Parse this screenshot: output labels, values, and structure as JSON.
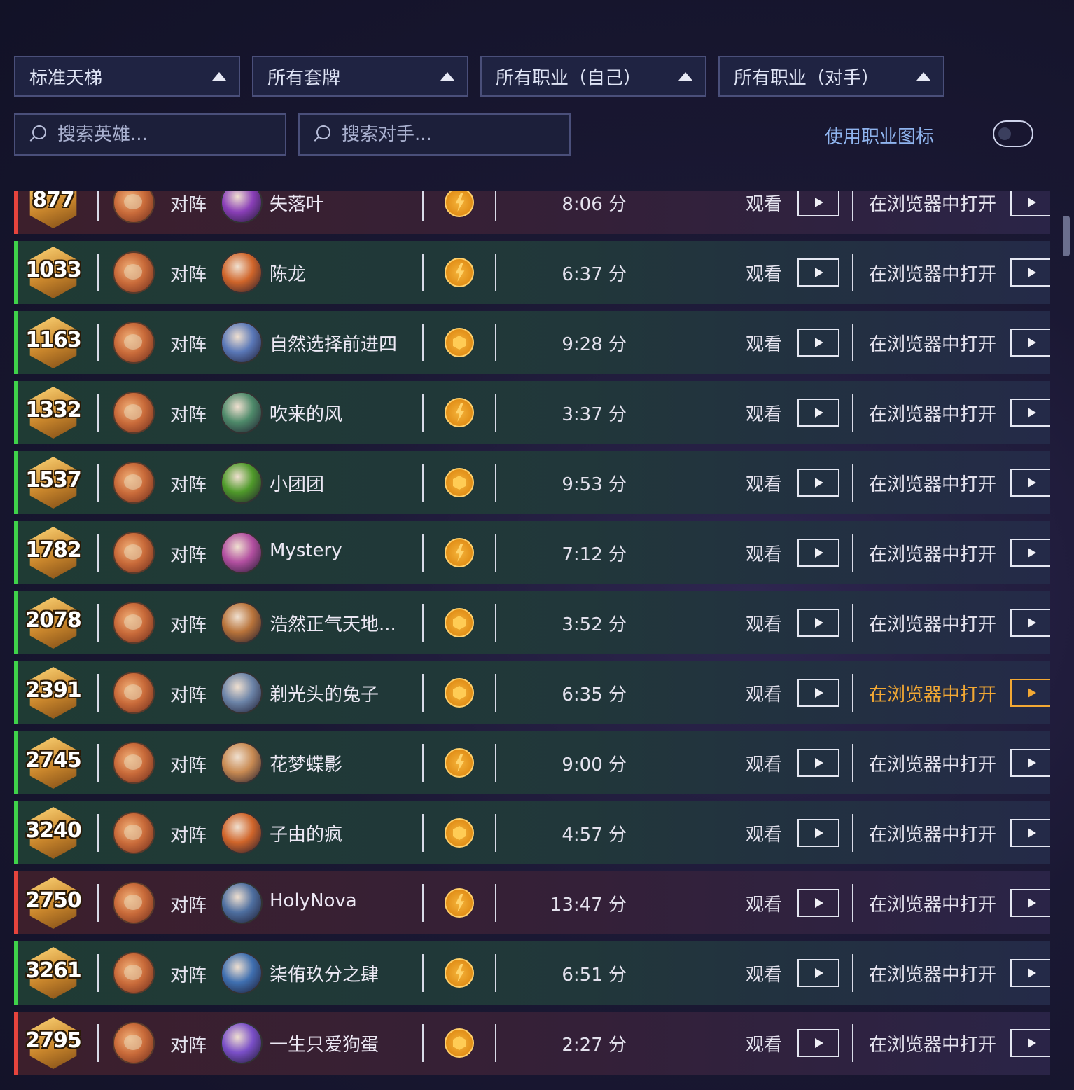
{
  "filters": [
    {
      "label": "标准天梯"
    },
    {
      "label": "所有套牌"
    },
    {
      "label": "所有职业（自己）"
    },
    {
      "label": "所有职业（对手）"
    }
  ],
  "search": {
    "hero_placeholder": "搜索英雄...",
    "opponent_placeholder": "搜索对手..."
  },
  "toggle": {
    "label": "使用职业图标",
    "on": false
  },
  "rows": [
    {
      "rank": "877",
      "vs": "对阵",
      "opponent": "失落叶",
      "mode": "bolt",
      "duration": "8:06 分",
      "watch": "观看",
      "browser": "在浏览器中打开",
      "result": "loss",
      "opp_color": "#8a3fb8"
    },
    {
      "rank": "1033",
      "vs": "对阵",
      "opponent": "陈龙",
      "mode": "bolt",
      "duration": "6:37 分",
      "watch": "观看",
      "browser": "在浏览器中打开",
      "result": "win",
      "opp_color": "#d0652a"
    },
    {
      "rank": "1163",
      "vs": "对阵",
      "opponent": "自然选择前进四",
      "mode": "coin",
      "duration": "9:28 分",
      "watch": "观看",
      "browser": "在浏览器中打开",
      "result": "win",
      "opp_color": "#5a78b8"
    },
    {
      "rank": "1332",
      "vs": "对阵",
      "opponent": "吹来的风",
      "mode": "bolt",
      "duration": "3:37 分",
      "watch": "观看",
      "browser": "在浏览器中打开",
      "result": "win",
      "opp_color": "#4e8a6a"
    },
    {
      "rank": "1537",
      "vs": "对阵",
      "opponent": "小团团",
      "mode": "coin",
      "duration": "9:53 分",
      "watch": "观看",
      "browser": "在浏览器中打开",
      "result": "win",
      "opp_color": "#4f9a2a"
    },
    {
      "rank": "1782",
      "vs": "对阵",
      "opponent": "Mystery",
      "mode": "bolt",
      "duration": "7:12 分",
      "watch": "观看",
      "browser": "在浏览器中打开",
      "result": "win",
      "opp_color": "#b24fa0"
    },
    {
      "rank": "2078",
      "vs": "对阵",
      "opponent": "浩然正气天地...",
      "mode": "coin",
      "duration": "3:52 分",
      "watch": "观看",
      "browser": "在浏览器中打开",
      "result": "win",
      "opp_color": "#b8733a"
    },
    {
      "rank": "2391",
      "vs": "对阵",
      "opponent": "剃光头的兔子",
      "mode": "coin",
      "duration": "6:35 分",
      "watch": "观看",
      "browser": "在浏览器中打开",
      "result": "win",
      "opp_color": "#6c84a8",
      "hover": true
    },
    {
      "rank": "2745",
      "vs": "对阵",
      "opponent": "花梦蝶影",
      "mode": "bolt",
      "duration": "9:00 分",
      "watch": "观看",
      "browser": "在浏览器中打开",
      "result": "win",
      "opp_color": "#c88a52"
    },
    {
      "rank": "3240",
      "vs": "对阵",
      "opponent": "子由的疯",
      "mode": "coin",
      "duration": "4:57 分",
      "watch": "观看",
      "browser": "在浏览器中打开",
      "result": "win",
      "opp_color": "#d0652a"
    },
    {
      "rank": "2750",
      "vs": "对阵",
      "opponent": "HolyNova",
      "mode": "bolt",
      "duration": "13:47 分",
      "watch": "观看",
      "browser": "在浏览器中打开",
      "result": "loss",
      "opp_color": "#4e6fa0"
    },
    {
      "rank": "3261",
      "vs": "对阵",
      "opponent": "柒侑玖分之肆",
      "mode": "bolt",
      "duration": "6:51 分",
      "watch": "观看",
      "browser": "在浏览器中打开",
      "result": "win",
      "opp_color": "#3f6fb0"
    },
    {
      "rank": "2795",
      "vs": "对阵",
      "opponent": "一生只爱狗蛋",
      "mode": "coin",
      "duration": "2:27 分",
      "watch": "观看",
      "browser": "在浏览器中打开",
      "result": "loss",
      "opp_color": "#7a4fc8"
    }
  ]
}
